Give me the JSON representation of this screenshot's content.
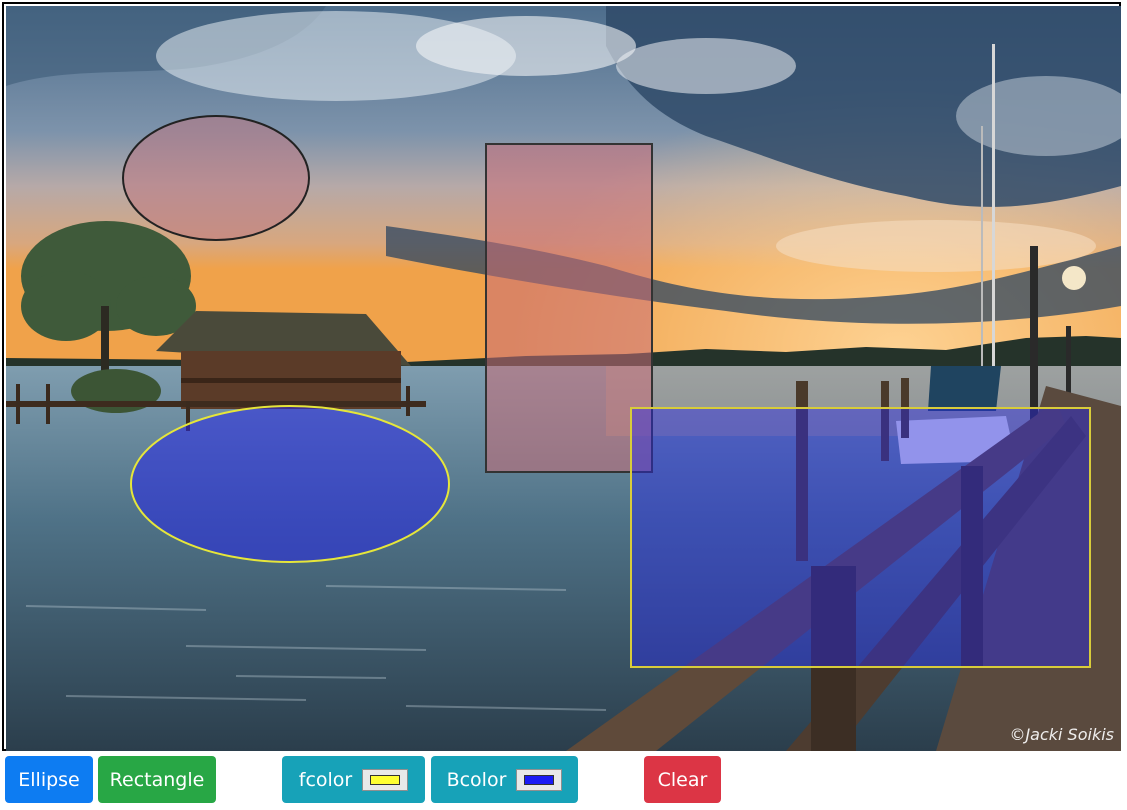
{
  "canvas": {
    "photo_description_label": "Lake scene with boathouse and pier at sunset",
    "watermark": "©Jacki Soikis"
  },
  "shapes": {
    "ellipse_1": {
      "fill": "rgba(190,120,130,0.55)",
      "stroke": "#222222"
    },
    "rect_1": {
      "fill": "rgba(200,110,120,0.55)",
      "stroke": "#333333"
    },
    "ellipse_2": {
      "fill": "rgba(40,40,230,0.55)",
      "stroke": "#e6e63a"
    },
    "rect_2": {
      "fill": "rgba(40,40,230,0.45)",
      "stroke": "#d8cc3a"
    }
  },
  "toolbar": {
    "ellipse_label": "Ellipse",
    "rectangle_label": "Rectangle",
    "fcolor_label": "fcolor",
    "fcolor_value": "#ffff33",
    "bcolor_label": "Bcolor",
    "bcolor_value": "#1b1bf5",
    "clear_label": "Clear"
  }
}
